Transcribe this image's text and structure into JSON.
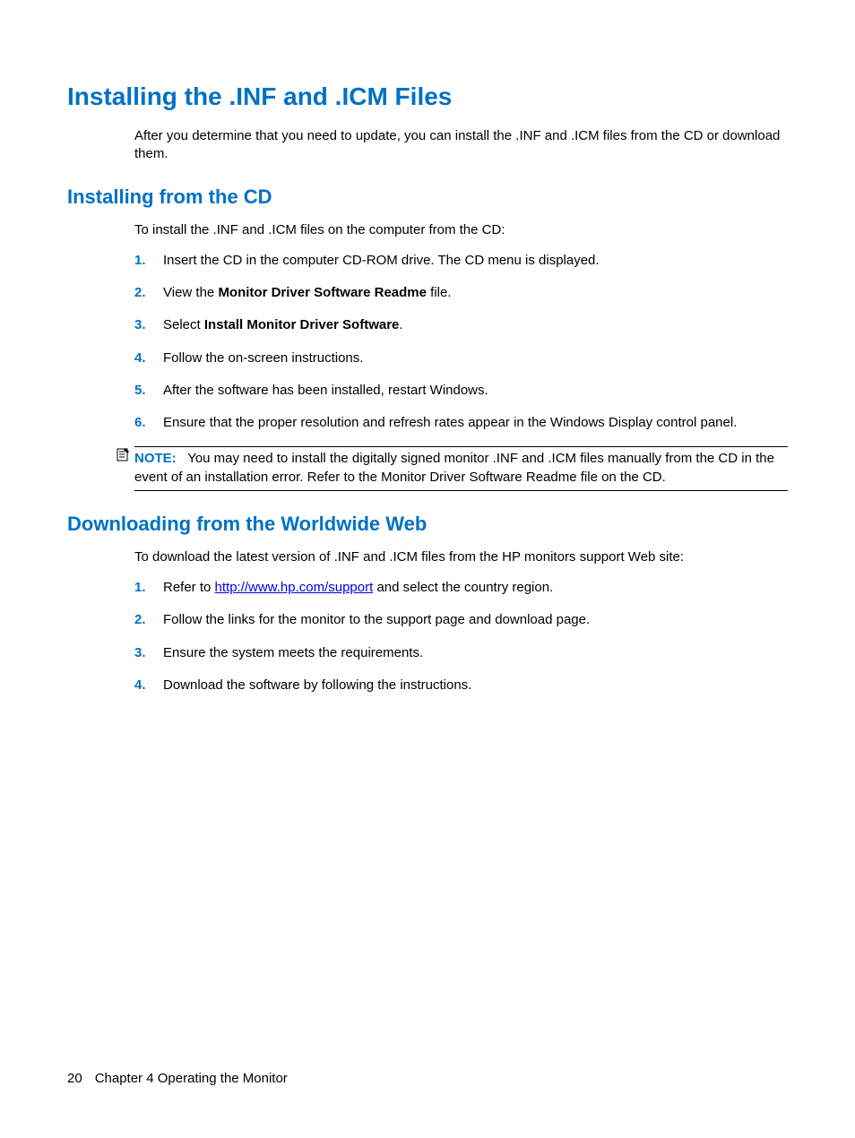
{
  "heading1": "Installing the .INF and .ICM Files",
  "intro": "After you determine that you need to update, you can install the .INF and .ICM files from the CD or download them.",
  "section1": {
    "heading": "Installing from the CD",
    "intro": "To install the .INF and .ICM files on the computer from the CD:",
    "steps": [
      {
        "num": "1.",
        "text": "Insert the CD in the computer CD-ROM drive. The CD menu is displayed."
      },
      {
        "num": "2.",
        "prefix": "View the ",
        "bold": "Monitor Driver Software Readme",
        "suffix": " file."
      },
      {
        "num": "3.",
        "prefix": "Select ",
        "bold": "Install Monitor Driver Software",
        "suffix": "."
      },
      {
        "num": "4.",
        "text": "Follow the on-screen instructions."
      },
      {
        "num": "5.",
        "text": "After the software has been installed, restart Windows."
      },
      {
        "num": "6.",
        "text": "Ensure that the proper resolution and refresh rates appear in the Windows Display control panel."
      }
    ],
    "note": {
      "label": "NOTE:",
      "text": "You may need to install the digitally signed monitor .INF and .ICM files manually from the CD in the event of an installation error. Refer to the Monitor Driver Software Readme file on the CD."
    }
  },
  "section2": {
    "heading": "Downloading from the Worldwide Web",
    "intro": "To download the latest version of .INF and .ICM files from the HP monitors support Web site:",
    "steps": [
      {
        "num": "1.",
        "prefix": "Refer to ",
        "link": "http://www.hp.com/support",
        "suffix": " and select the country region."
      },
      {
        "num": "2.",
        "text": "Follow the links for the monitor to the support page and download page."
      },
      {
        "num": "3.",
        "text": "Ensure the system meets the requirements."
      },
      {
        "num": "4.",
        "text": "Download the software by following the instructions."
      }
    ]
  },
  "footer": {
    "page": "20",
    "chapter": "Chapter 4   Operating the Monitor"
  }
}
